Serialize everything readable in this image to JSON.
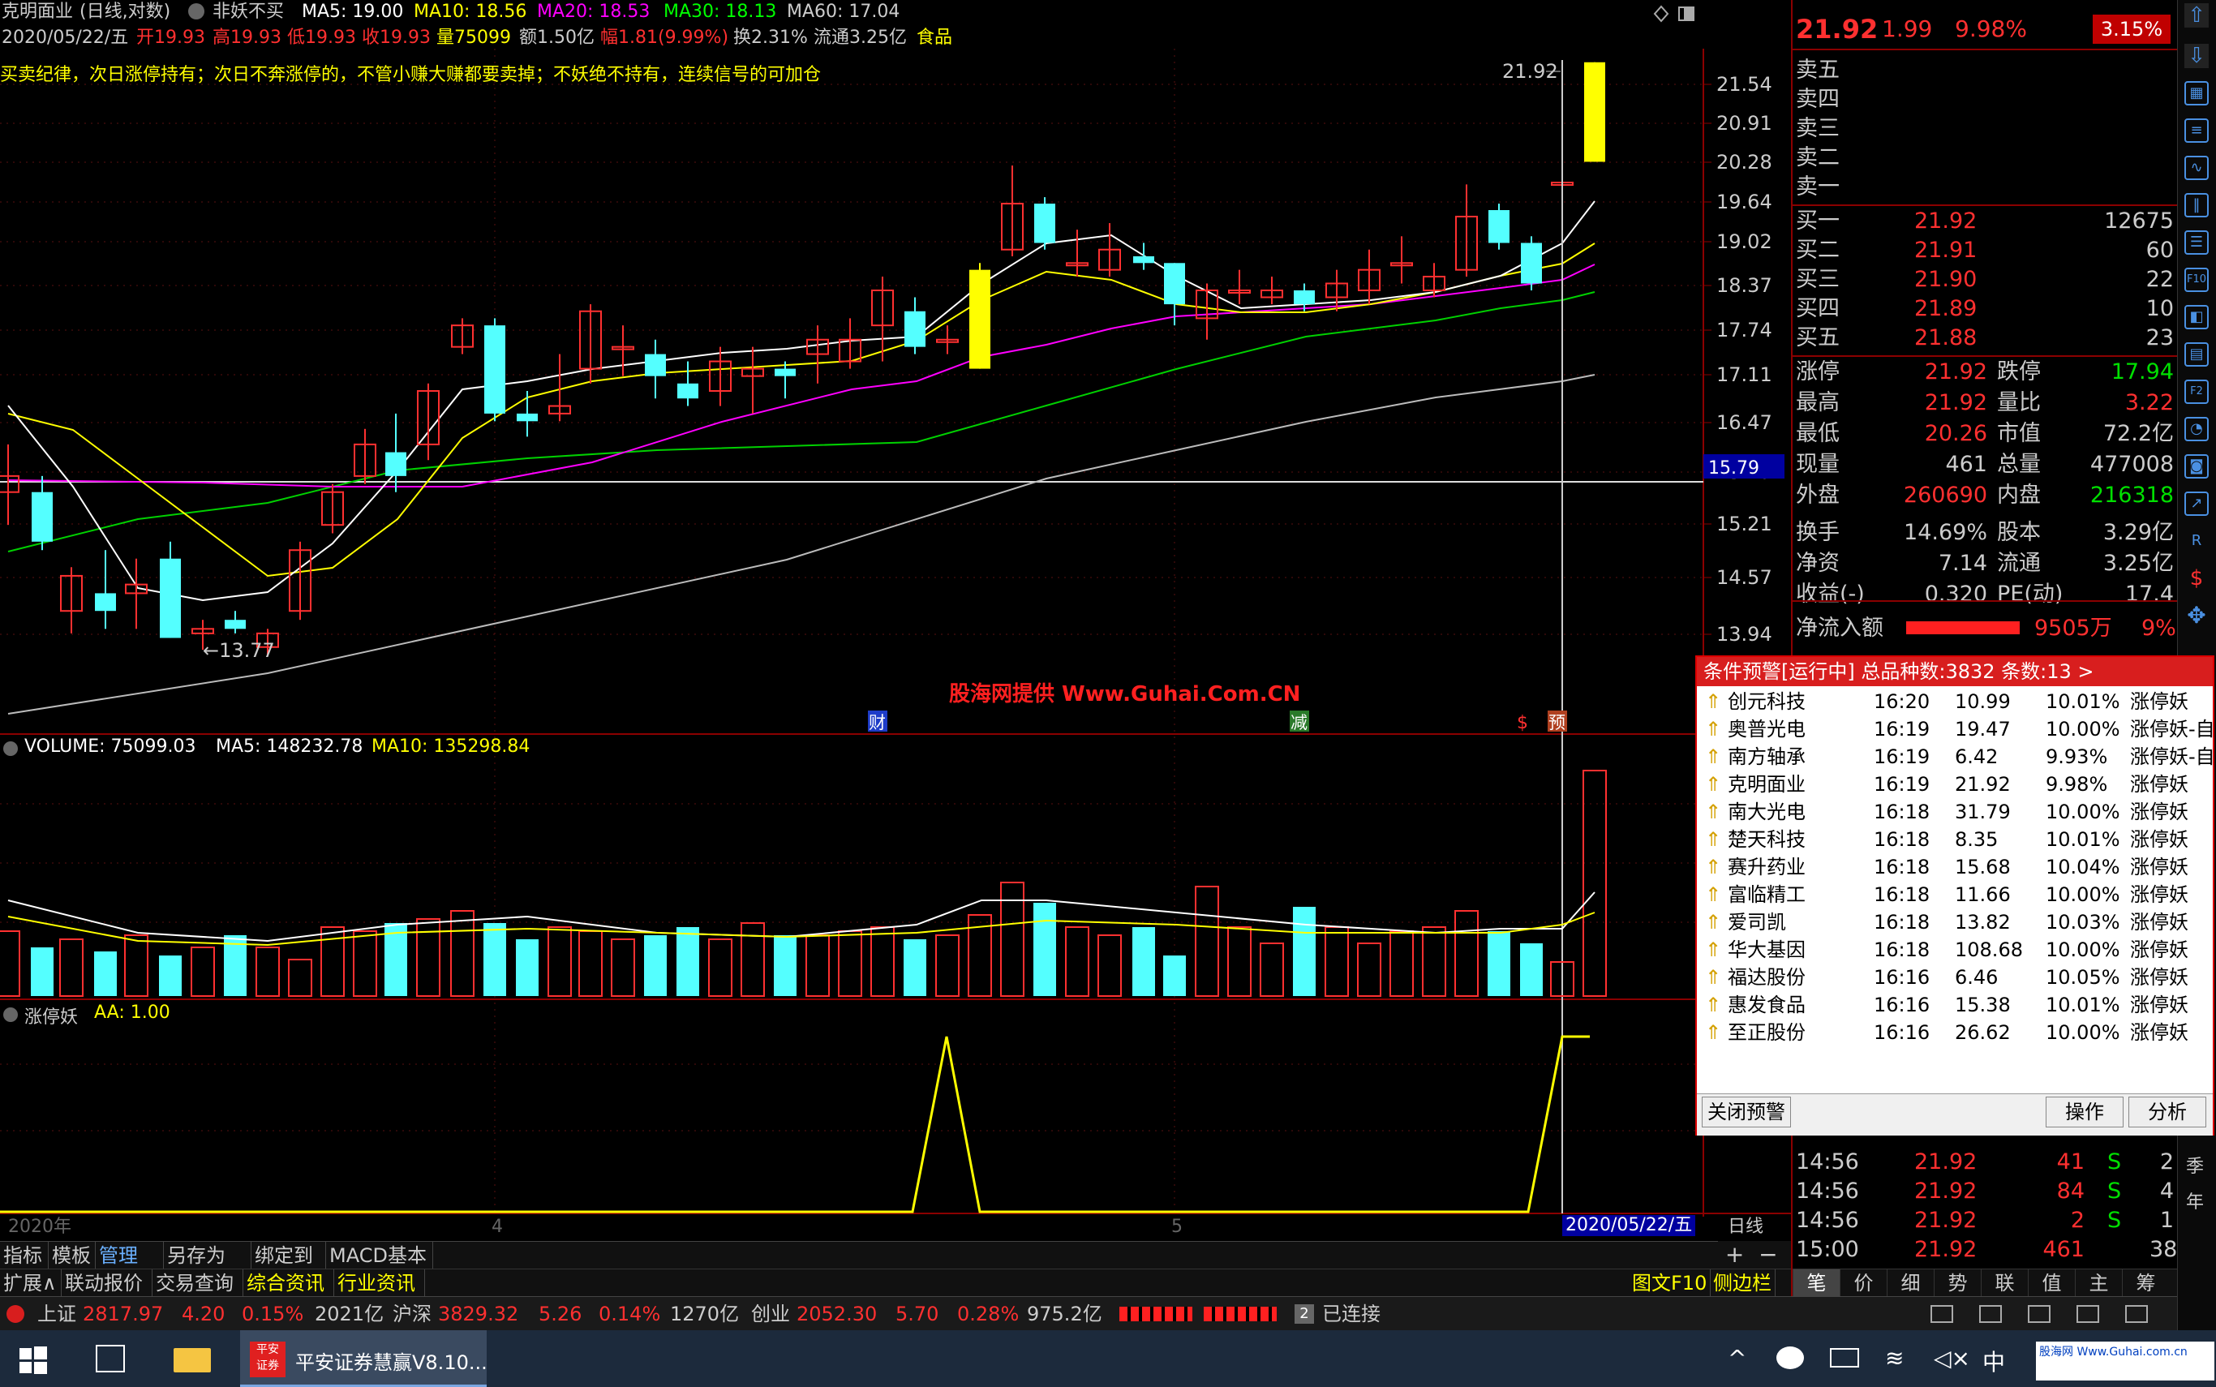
{
  "header": {
    "stock": "克明面业",
    "period": "(日线,对数)",
    "indicator": "非妖不买",
    "ma5": "MA5: 19.00",
    "ma10": "MA10: 18.56",
    "ma20": "MA20: 18.53",
    "ma30": "MA30: 18.13",
    "ma60": "MA60: 17.04",
    "date": "2020/05/22/五",
    "open": "开19.93",
    "high": "高19.93",
    "low": "低19.93",
    "close": "收19.93",
    "vol": "量75099",
    "amount": "额1.50亿",
    "change": "幅1.81(9.99%)",
    "turnover": "换2.31%",
    "float": "流通3.25亿",
    "sector": "食品"
  },
  "formula_text": "买卖纪律，次日涨停持有；次日不奔涨停的，不管小赚大赚都要卖掉；不妖绝不持有，连续信号的可加仓",
  "price_axis": [
    "21.54",
    "20.91",
    "20.28",
    "19.64",
    "19.02",
    "18.37",
    "17.74",
    "17.11",
    "16.47",
    "15.79",
    "15.21",
    "14.57",
    "13.94"
  ],
  "current_price_tag": "15.79",
  "high_label": "21.92",
  "low_label": "13.77",
  "watermark": "股海网提供 Www.Guhai.Com.CN",
  "event_markers": [
    "财",
    "减",
    "$",
    "预"
  ],
  "volume_title": {
    "name": "VOLUME: 75099.03",
    "ma5": "MA5: 148232.78",
    "ma10": "MA10: 135298.84"
  },
  "zt_title": {
    "name": "涨停妖",
    "aa": "AA: 1.00"
  },
  "x_axis": {
    "year": "2020年",
    "m4": "4",
    "m5": "5",
    "cursor_date": "2020/05/22/五",
    "period": "日线"
  },
  "quote": {
    "price": "21.92",
    "change": "1.99",
    "pct": "9.98%",
    "badge": "3.15%",
    "sell": [
      {
        "label": "卖五",
        "price": "",
        "vol": ""
      },
      {
        "label": "卖四",
        "price": "",
        "vol": ""
      },
      {
        "label": "卖三",
        "price": "",
        "vol": ""
      },
      {
        "label": "卖二",
        "price": "",
        "vol": ""
      },
      {
        "label": "卖一",
        "price": "",
        "vol": ""
      }
    ],
    "buy": [
      {
        "label": "买一",
        "price": "21.92",
        "vol": "12675"
      },
      {
        "label": "买二",
        "price": "21.91",
        "vol": "60"
      },
      {
        "label": "买三",
        "price": "21.90",
        "vol": "22"
      },
      {
        "label": "买四",
        "price": "21.89",
        "vol": "10"
      },
      {
        "label": "买五",
        "price": "21.88",
        "vol": "23"
      }
    ],
    "stats": [
      {
        "l1": "涨停",
        "v1": "21.92",
        "l2": "跌停",
        "v2": "17.94",
        "c1": "#ff3030",
        "c2": "#00e000"
      },
      {
        "l1": "最高",
        "v1": "21.92",
        "l2": "量比",
        "v2": "3.22",
        "c1": "#ff3030",
        "c2": "#ff3030"
      },
      {
        "l1": "最低",
        "v1": "20.26",
        "l2": "市值",
        "v2": "72.2亿",
        "c1": "#ff3030",
        "c2": "#ccc"
      },
      {
        "l1": "现量",
        "v1": "461",
        "l2": "总量",
        "v2": "477008",
        "c1": "#ccc",
        "c2": "#ccc"
      },
      {
        "l1": "外盘",
        "v1": "260690",
        "l2": "内盘",
        "v2": "216318",
        "c1": "#ff3030",
        "c2": "#00e000"
      },
      {
        "l1": "换手",
        "v1": "14.69%",
        "l2": "股本",
        "v2": "3.29亿",
        "c1": "#ccc",
        "c2": "#ccc"
      },
      {
        "l1": "净资",
        "v1": "7.14",
        "l2": "流通",
        "v2": "3.25亿",
        "c1": "#ccc",
        "c2": "#ccc"
      },
      {
        "l1": "收益(-)",
        "v1": "0.320",
        "l2": "PE(动)",
        "v2": "17.4",
        "c1": "#ccc",
        "c2": "#ccc"
      }
    ],
    "net_inflow_label": "净流入额",
    "net_inflow": "9505万",
    "net_inflow_pct": "9%",
    "ticks": [
      {
        "time": "14:56",
        "price": "21.92",
        "vol": "41",
        "bs": "S",
        "n": "2"
      },
      {
        "time": "14:56",
        "price": "21.92",
        "vol": "84",
        "bs": "S",
        "n": "4"
      },
      {
        "time": "14:56",
        "price": "21.92",
        "vol": "2",
        "bs": "S",
        "n": "1"
      },
      {
        "time": "15:00",
        "price": "21.92",
        "vol": "461",
        "bs": "",
        "n": "38"
      }
    ],
    "bottom_tabs": [
      "笔",
      "价",
      "细",
      "势",
      "联",
      "值",
      "主",
      "筹"
    ]
  },
  "alert": {
    "title": "条件预警[运行中] 总品种数:3832 条数:13  >",
    "rows": [
      {
        "name": "创元科技",
        "time": "16:20",
        "price": "10.99",
        "pct": "10.01%",
        "sig": "涨停妖"
      },
      {
        "name": "奥普光电",
        "time": "16:19",
        "price": "19.47",
        "pct": "10.00%",
        "sig": "涨停妖-自"
      },
      {
        "name": "南方轴承",
        "time": "16:19",
        "price": "6.42",
        "pct": "9.93%",
        "sig": "涨停妖-自"
      },
      {
        "name": "克明面业",
        "time": "16:19",
        "price": "21.92",
        "pct": "9.98%",
        "sig": "涨停妖"
      },
      {
        "name": "南大光电",
        "time": "16:18",
        "price": "31.79",
        "pct": "10.00%",
        "sig": "涨停妖"
      },
      {
        "name": "楚天科技",
        "time": "16:18",
        "price": "8.35",
        "pct": "10.01%",
        "sig": "涨停妖"
      },
      {
        "name": "赛升药业",
        "time": "16:18",
        "price": "15.68",
        "pct": "10.04%",
        "sig": "涨停妖"
      },
      {
        "name": "富临精工",
        "time": "16:18",
        "price": "11.66",
        "pct": "10.00%",
        "sig": "涨停妖"
      },
      {
        "name": "爱司凯",
        "time": "16:18",
        "price": "13.82",
        "pct": "10.03%",
        "sig": "涨停妖"
      },
      {
        "name": "华大基因",
        "time": "16:18",
        "price": "108.68",
        "pct": "10.00%",
        "sig": "涨停妖"
      },
      {
        "name": "福达股份",
        "time": "16:16",
        "price": "6.46",
        "pct": "10.05%",
        "sig": "涨停妖"
      },
      {
        "name": "惠发食品",
        "time": "16:16",
        "price": "15.38",
        "pct": "10.01%",
        "sig": "涨停妖"
      },
      {
        "name": "至正股份",
        "time": "16:16",
        "price": "26.62",
        "pct": "10.00%",
        "sig": "涨停妖"
      }
    ],
    "close_btn": "关闭预警",
    "op_btn": "操作",
    "analyze_btn": "分析"
  },
  "tabs_row1": [
    "指标",
    "模板",
    "管理",
    "另存为",
    "绑定到",
    "MACD基本"
  ],
  "tabs_row2": [
    "扩展∧",
    "联动报价",
    "交易查询",
    "综合资讯",
    "行业资讯"
  ],
  "tabs_right": [
    "图文F10",
    "侧边栏"
  ],
  "status": {
    "sh_label": "上证",
    "sh": "2817.97",
    "sh_chg": "4.20",
    "sh_pct": "0.15%",
    "sh_amt": "2021亿",
    "hs_label": "沪深",
    "hs": "3829.32",
    "hs_chg": "5.26",
    "hs_pct": "0.14%",
    "hs_amt": "1270亿",
    "cy_label": "创业",
    "cy": "2052.30",
    "cy_chg": "5.70",
    "cy_pct": "0.28%",
    "cy_amt": "975.2亿",
    "conn_num": "2",
    "conn": "已连接"
  },
  "taskbar": {
    "app": "平安证券慧赢V8.10...",
    "ime": "中",
    "app_icon_text": "平安\n证券",
    "watermark": "股海网 Www.Guhai.com.cn"
  }
}
